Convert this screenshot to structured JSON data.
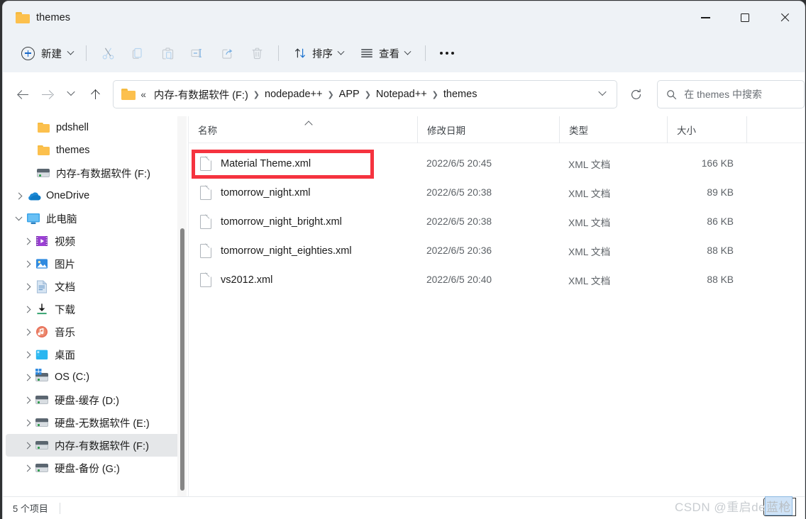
{
  "window": {
    "title": "themes",
    "folder_icon": "folder-icon",
    "controls": {
      "minimize": "minimize-button",
      "maximize": "maximize-button",
      "close": "close-button"
    }
  },
  "toolbar": {
    "new_label": "新建",
    "items": [
      {
        "name": "cut-icon",
        "label": "剪切",
        "enabled": false
      },
      {
        "name": "copy-icon",
        "label": "复制",
        "enabled": false
      },
      {
        "name": "paste-icon",
        "label": "粘贴",
        "enabled": false
      },
      {
        "name": "rename-icon",
        "label": "重命名",
        "enabled": false
      },
      {
        "name": "share-icon",
        "label": "共享",
        "enabled": false
      },
      {
        "name": "delete-icon",
        "label": "删除",
        "enabled": false
      }
    ],
    "sort_label": "排序",
    "view_label": "查看",
    "more_label": "查看更多"
  },
  "address": {
    "back": "后退",
    "forward": "前进",
    "recent": "最近的位置",
    "up": "向上",
    "separator_glyph": "«",
    "crumbs": [
      "内存-有数据软件 (F:)",
      "nodepade++",
      "APP",
      "Notepad++",
      "themes"
    ],
    "refresh": "刷新",
    "dropdown": "历史记录"
  },
  "search": {
    "placeholder": "在 themes 中搜索",
    "icon": "search-icon"
  },
  "sidebar": {
    "items": [
      {
        "label": "pdshell",
        "icon": "folder-icon",
        "indent": 2,
        "twisty": "none",
        "selected": false
      },
      {
        "label": "themes",
        "icon": "folder-icon",
        "indent": 2,
        "twisty": "none",
        "selected": false
      },
      {
        "label": "内存-有数据软件 (F:)",
        "icon": "drive-icon",
        "indent": 2,
        "twisty": "none",
        "selected": false
      },
      {
        "label": "OneDrive",
        "icon": "onedrive-icon",
        "indent": 0,
        "twisty": "collapsed",
        "selected": false
      },
      {
        "label": "此电脑",
        "icon": "pc-icon",
        "indent": 0,
        "twisty": "expanded",
        "selected": false
      },
      {
        "label": "视频",
        "icon": "videos-icon",
        "indent": 1,
        "twisty": "collapsed",
        "selected": false
      },
      {
        "label": "图片",
        "icon": "pictures-icon",
        "indent": 1,
        "twisty": "collapsed",
        "selected": false
      },
      {
        "label": "文档",
        "icon": "documents-icon",
        "indent": 1,
        "twisty": "collapsed",
        "selected": false
      },
      {
        "label": "下载",
        "icon": "downloads-icon",
        "indent": 1,
        "twisty": "collapsed",
        "selected": false
      },
      {
        "label": "音乐",
        "icon": "music-icon",
        "indent": 1,
        "twisty": "collapsed",
        "selected": false
      },
      {
        "label": "桌面",
        "icon": "desktop-icon",
        "indent": 1,
        "twisty": "collapsed",
        "selected": false
      },
      {
        "label": "OS (C:)",
        "icon": "os-drive-icon",
        "indent": 1,
        "twisty": "collapsed",
        "selected": false
      },
      {
        "label": "硬盘-缓存 (D:)",
        "icon": "drive-icon",
        "indent": 1,
        "twisty": "collapsed",
        "selected": false
      },
      {
        "label": "硬盘-无数据软件 (E:)",
        "icon": "drive-icon",
        "indent": 1,
        "twisty": "collapsed",
        "selected": false
      },
      {
        "label": "内存-有数据软件 (F:)",
        "icon": "drive-icon",
        "indent": 1,
        "twisty": "collapsed",
        "selected": true
      },
      {
        "label": "硬盘-备份 (G:)",
        "icon": "drive-icon",
        "indent": 1,
        "twisty": "collapsed",
        "selected": false
      }
    ]
  },
  "filelist": {
    "columns": [
      {
        "key": "name",
        "label": "名称",
        "sorted": "asc"
      },
      {
        "key": "date",
        "label": "修改日期",
        "sorted": ""
      },
      {
        "key": "type",
        "label": "类型",
        "sorted": ""
      },
      {
        "key": "size",
        "label": "大小",
        "sorted": ""
      }
    ],
    "rows": [
      {
        "name": "Material Theme.xml",
        "date": "2022/6/5 20:45",
        "type": "XML 文档",
        "size": "166 KB",
        "icon": "xml-file-icon",
        "highlighted": true
      },
      {
        "name": "tomorrow_night.xml",
        "date": "2022/6/5 20:38",
        "type": "XML 文档",
        "size": "89 KB",
        "icon": "xml-file-icon",
        "highlighted": false
      },
      {
        "name": "tomorrow_night_bright.xml",
        "date": "2022/6/5 20:38",
        "type": "XML 文档",
        "size": "86 KB",
        "icon": "xml-file-icon",
        "highlighted": false
      },
      {
        "name": "tomorrow_night_eighties.xml",
        "date": "2022/6/5 20:36",
        "type": "XML 文档",
        "size": "88 KB",
        "icon": "xml-file-icon",
        "highlighted": false
      },
      {
        "name": "vs2012.xml",
        "date": "2022/6/5 20:40",
        "type": "XML 文档",
        "size": "88 KB",
        "icon": "xml-file-icon",
        "highlighted": false
      }
    ]
  },
  "statusbar": {
    "item_count": "5 个项目"
  },
  "watermark": {
    "prefix": "CSDN @重启de",
    "highlighted": "蓝枪"
  },
  "colors": {
    "accent": "#1767c9",
    "annotation": "#f5333f",
    "chrome": "#eef2f6",
    "selected_row": "#e5e7e9",
    "folder": "#fcc04d"
  }
}
